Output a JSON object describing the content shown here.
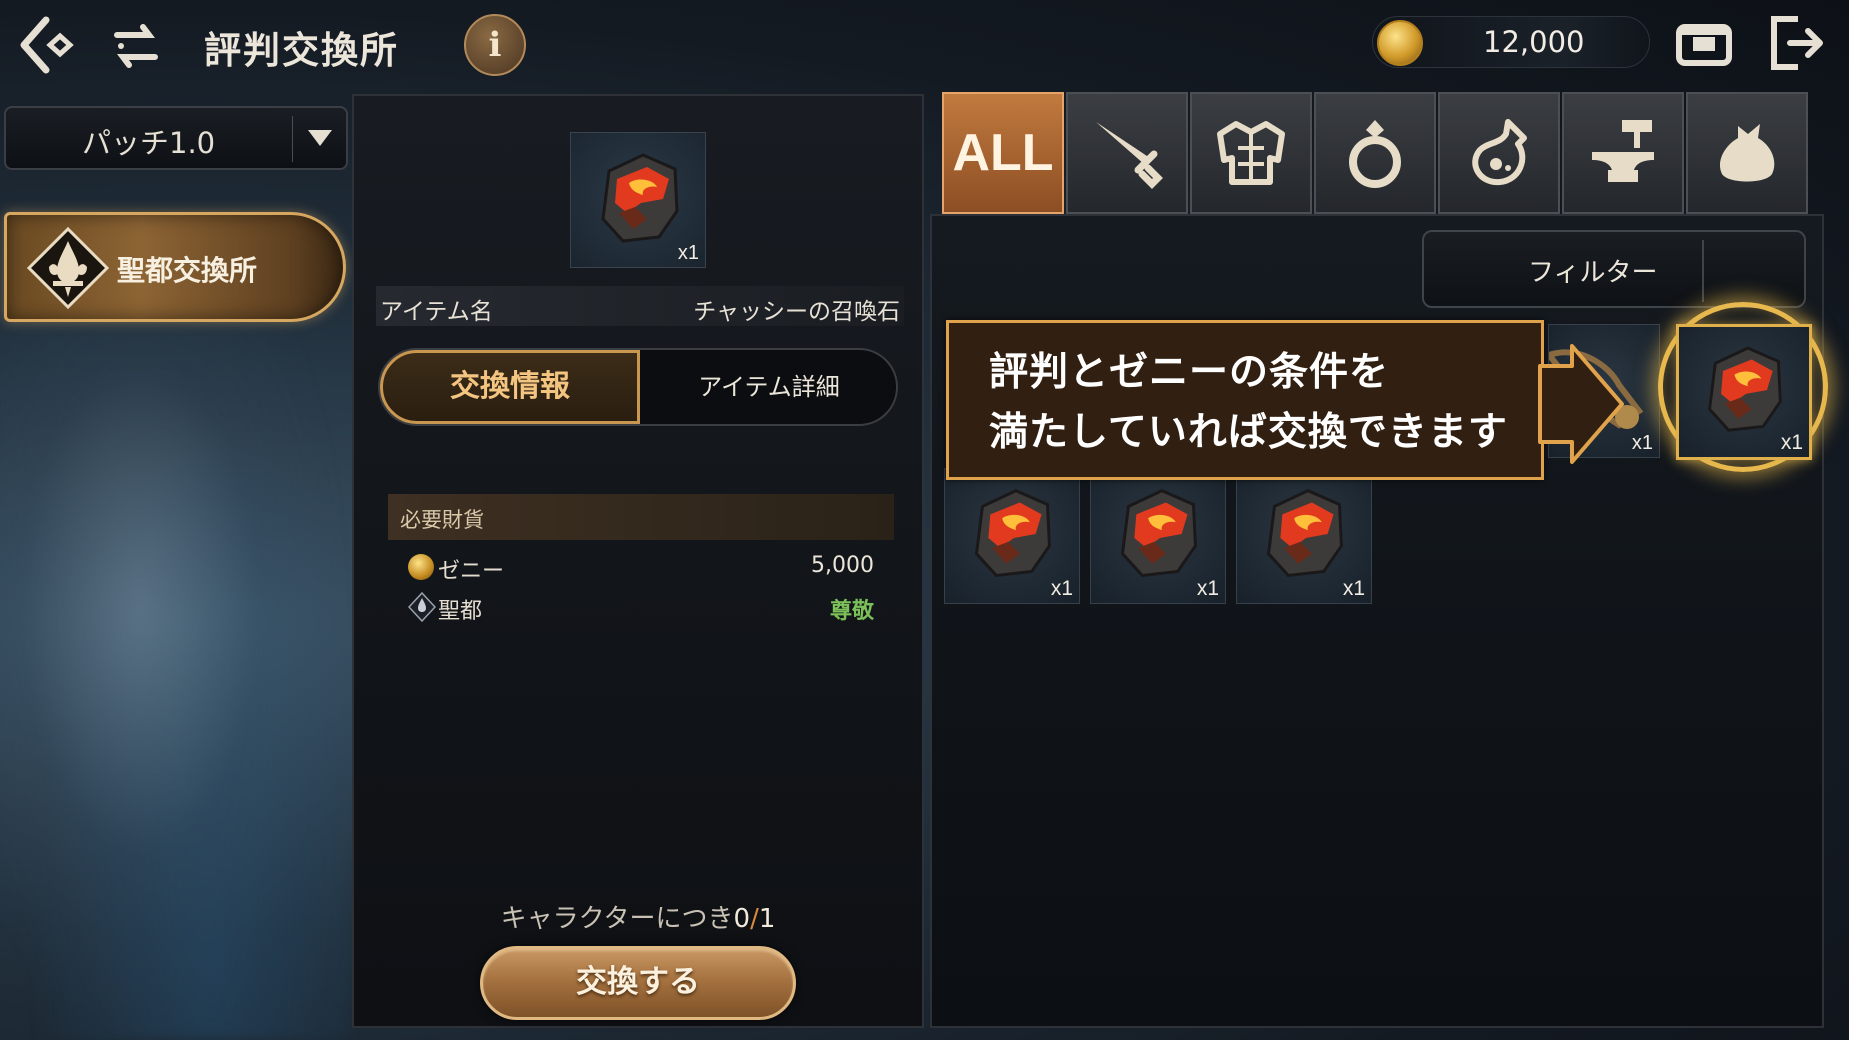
{
  "header": {
    "title": "評判交換所",
    "info_label": "i",
    "currency_value": "12,000"
  },
  "sidebar": {
    "patch_select": "パッチ1.0",
    "shop_tab_label": "聖都交換所"
  },
  "detail": {
    "item_qty": "x1",
    "item_name_key": "アイテム名",
    "item_name_value": "チャッシーの召喚石",
    "tabs": {
      "exchange_info": "交換情報",
      "item_detail": "アイテム詳細"
    },
    "required_header": "必要財貨",
    "requirements": [
      {
        "icon": "zeny-coin-icon",
        "name": "ゼニー",
        "value": "5,000"
      },
      {
        "icon": "holy-city-emblem-icon",
        "name": "聖都",
        "value": "尊敬"
      }
    ],
    "limit_prefix": "キャラクターにつき",
    "limit_current": "0",
    "limit_sep": "/",
    "limit_max": "1",
    "exchange_button": "交換する"
  },
  "shop": {
    "categories": [
      {
        "id": "all",
        "label": "ALL",
        "icon": "all-text"
      },
      {
        "id": "weapon",
        "label": "",
        "icon": "sword-icon"
      },
      {
        "id": "armor",
        "label": "",
        "icon": "armor-icon"
      },
      {
        "id": "accessory",
        "label": "",
        "icon": "ring-icon"
      },
      {
        "id": "consumable",
        "label": "",
        "icon": "potion-icon"
      },
      {
        "id": "crafting",
        "label": "",
        "icon": "anvil-icon"
      },
      {
        "id": "etc",
        "label": "",
        "icon": "pouch-icon"
      }
    ],
    "filter_label": "フィルター",
    "items": [
      {
        "icon": "summon-stone-icon",
        "qty": "x1"
      },
      {
        "icon": "summon-stone-icon",
        "qty": "x1"
      },
      {
        "icon": "summon-stone-icon",
        "qty": "x1"
      }
    ],
    "partial_item": {
      "icon": "gear-item-icon",
      "qty": "x1"
    },
    "highlighted_item": {
      "icon": "summon-stone-icon",
      "qty": "x1"
    }
  },
  "tooltip": {
    "line1": "評判とゼニーの条件を",
    "line2": "満たしていれば交換できます"
  },
  "colors": {
    "accent_gold": "#e0a24a",
    "tab_active": "#c17a3e",
    "respect_green": "#7cc05a"
  }
}
